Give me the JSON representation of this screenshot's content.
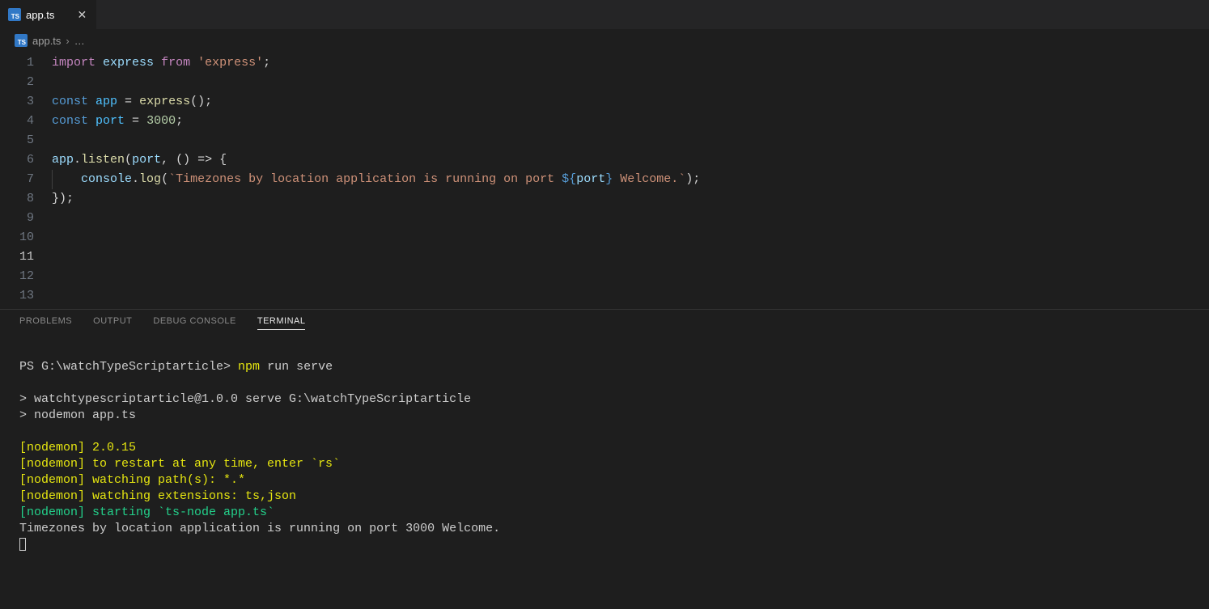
{
  "tab": {
    "icon_text": "TS",
    "filename": "app.ts",
    "close_glyph": "✕"
  },
  "breadcrumb": {
    "icon_text": "TS",
    "filename": "app.ts",
    "chevron": "›",
    "ellipsis": "…"
  },
  "editor": {
    "lines": [
      "1",
      "2",
      "3",
      "4",
      "5",
      "6",
      "7",
      "8",
      "9",
      "10",
      "11",
      "12",
      "13"
    ],
    "active_line": "11",
    "l1": {
      "import": "import",
      "express": "express",
      "from": "from",
      "str": "'express'",
      "semi": ";"
    },
    "l3": {
      "const": "const",
      "app": "app",
      "eq": " = ",
      "fn": "express",
      "rest": "();"
    },
    "l4": {
      "const": "const",
      "port": "port",
      "eq": " = ",
      "num": "3000",
      "semi": ";"
    },
    "l6": {
      "app": "app",
      "dot": ".",
      "listen": "listen",
      "open": "(",
      "port": "port",
      "rest": ", () => {"
    },
    "l7": {
      "indent": "    ",
      "console": "console",
      "dot": ".",
      "log": "log",
      "open": "(",
      "tick1": "`",
      "text1": "Timezones by location application is running on port ",
      "interp_open": "${",
      "interp_var": "port",
      "interp_close": "}",
      "text2": " Welcome.",
      "tick2": "`",
      "close": ");"
    },
    "l8": {
      "text": "});"
    }
  },
  "panel": {
    "tabs": {
      "problems": "PROBLEMS",
      "output": "OUTPUT",
      "debug": "DEBUG CONSOLE",
      "terminal": "TERMINAL"
    },
    "terminal": {
      "prompt_prefix": "PS G:\\watchTypeScriptarticle> ",
      "cmd_part1": "npm",
      "cmd_part2": " run serve",
      "line_blank": "",
      "line_serve": "> watchtypescriptarticle@1.0.0 serve G:\\watchTypeScriptarticle",
      "line_nodemon": "> nodemon app.ts",
      "y1": "[nodemon] 2.0.15",
      "y2": "[nodemon] to restart at any time, enter `rs`",
      "y3": "[nodemon] watching path(s): *.*",
      "y4": "[nodemon] watching extensions: ts,json",
      "g1": "[nodemon] starting `ts-node app.ts`",
      "out1": "Timezones by location application is running on port 3000 Welcome."
    }
  }
}
